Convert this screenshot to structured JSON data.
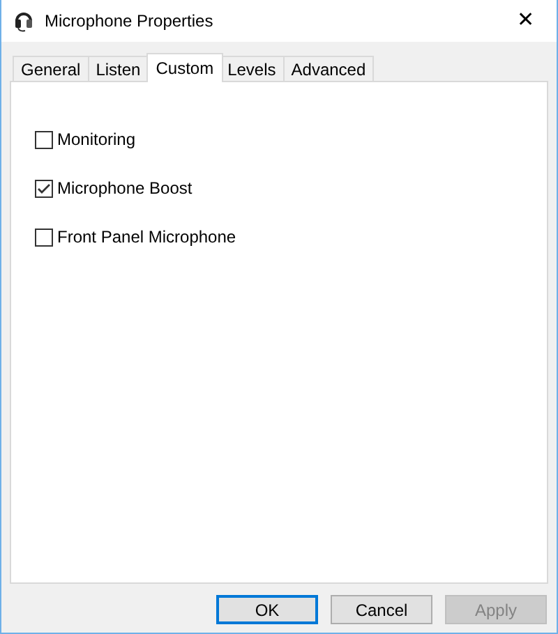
{
  "window": {
    "title": "Microphone Properties",
    "close": "✕"
  },
  "tabs": [
    {
      "label": "General",
      "selected": false
    },
    {
      "label": "Listen",
      "selected": false
    },
    {
      "label": "Custom",
      "selected": true
    },
    {
      "label": "Levels",
      "selected": false
    },
    {
      "label": "Advanced",
      "selected": false
    }
  ],
  "options": [
    {
      "label": "Monitoring",
      "checked": false
    },
    {
      "label": "Microphone Boost",
      "checked": true
    },
    {
      "label": "Front Panel Microphone",
      "checked": false
    }
  ],
  "buttons": [
    {
      "label": "OK",
      "default": true,
      "disabled": false
    },
    {
      "label": "Cancel",
      "default": false,
      "disabled": false
    },
    {
      "label": "Apply",
      "default": false,
      "disabled": true
    }
  ]
}
